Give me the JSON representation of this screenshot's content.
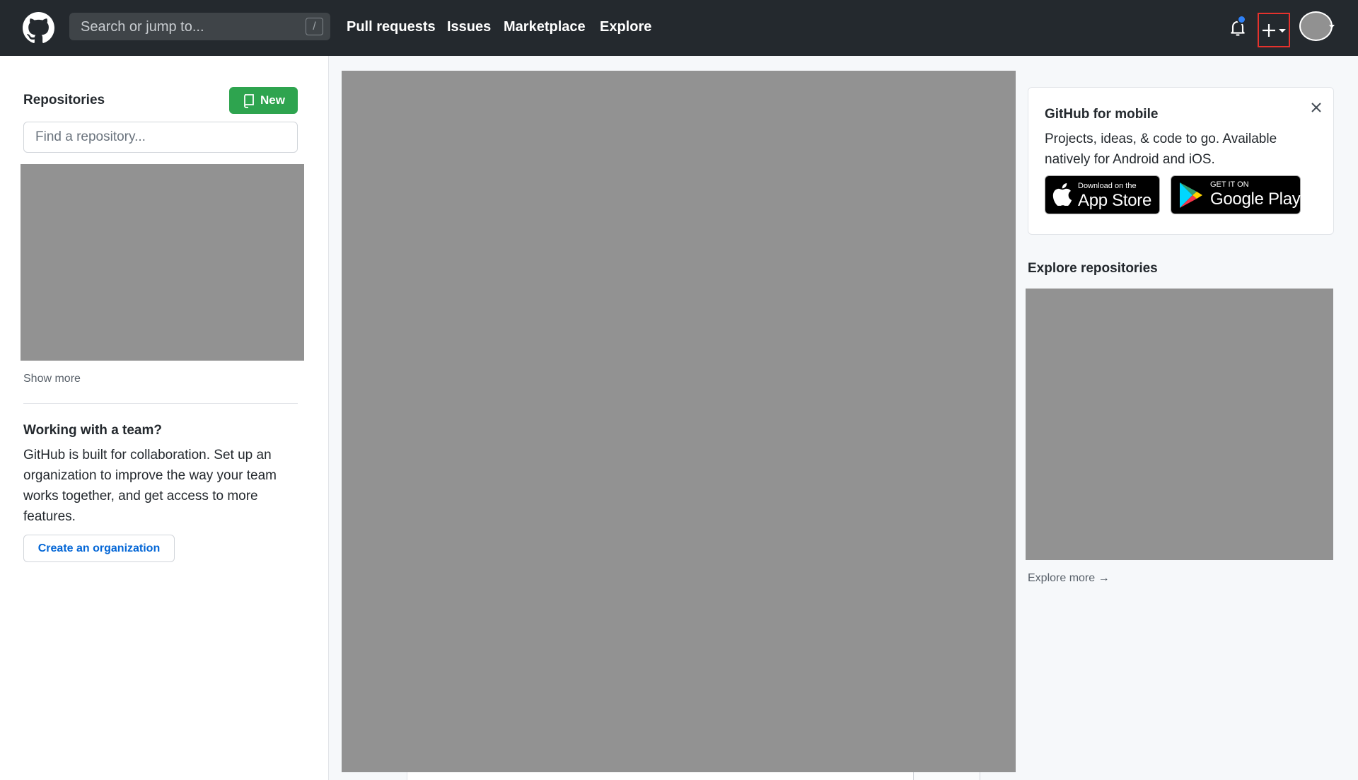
{
  "header": {
    "search_placeholder": "Search or jump to...",
    "search_shortcut": "/",
    "nav": [
      "Pull requests",
      "Issues",
      "Marketplace",
      "Explore"
    ],
    "notification_dot_color": "#2f81f7",
    "create_highlight_color": "#e5322d"
  },
  "sidebar": {
    "repos_heading": "Repositories",
    "new_button": "New",
    "find_placeholder": "Find a repository...",
    "show_more": "Show more",
    "team_heading": "Working with a team?",
    "team_text": "GitHub is built for collaboration. Set up an organization to improve the way your team works together, and get access to more features.",
    "create_org": "Create an organization"
  },
  "right": {
    "mobile_title": "GitHub for mobile",
    "mobile_text": "Projects, ideas, & code to go. Available natively for Android and iOS.",
    "app_store_small": "Download on the",
    "app_store_big": "App Store",
    "google_play_small": "GET IT ON",
    "google_play_big": "Google Play",
    "explore_heading": "Explore repositories",
    "explore_more": "Explore more →"
  },
  "colors": {
    "header_bg": "#24292e",
    "new_button_bg": "#2ea44f",
    "link": "#0366d6",
    "placeholder": "#929292"
  }
}
